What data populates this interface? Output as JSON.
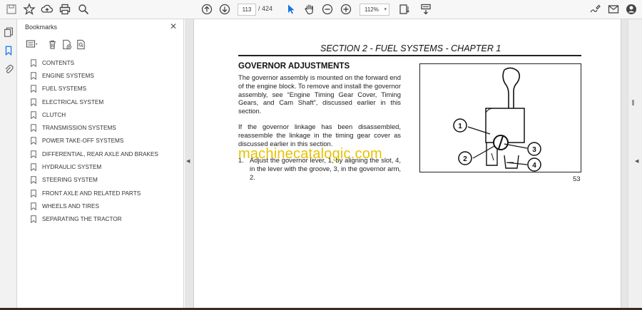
{
  "toolbar": {
    "current_page": "113",
    "page_separator": "/",
    "total_pages": "424",
    "zoom": "112%"
  },
  "bookmarks": {
    "title": "Bookmarks",
    "close_glyph": "✕",
    "items": [
      {
        "label": "CONTENTS"
      },
      {
        "label": "ENGINE SYSTEMS"
      },
      {
        "label": "FUEL SYSTEMS"
      },
      {
        "label": "ELECTRICAL SYSTEM"
      },
      {
        "label": "CLUTCH"
      },
      {
        "label": "TRANSMISSION SYSTEMS"
      },
      {
        "label": "POWER TAKE-OFF SYSTEMS"
      },
      {
        "label": "DIFFERENTIAL, REAR AXLE AND BRAKES"
      },
      {
        "label": "HYDRAULIC SYSTEM"
      },
      {
        "label": "STEERING SYSTEM"
      },
      {
        "label": "FRONT AXLE AND RELATED PARTS"
      },
      {
        "label": "WHEELS AND TIRES"
      },
      {
        "label": "SEPARATING THE TRACTOR"
      }
    ]
  },
  "document": {
    "section_header": "SECTION 2 - FUEL SYSTEMS - CHAPTER 1",
    "heading": "GOVERNOR ADJUSTMENTS",
    "paragraph1": "The governor assembly is mounted on the forward end of the engine block. To remove and install the governor assembly, see “Engine Timing Gear Cover, Timing Gears, and Cam Shaft”, discussed earlier in this section.",
    "paragraph2": "If the governor linkage has been disassembled, reassemble the linkage in the timing gear cover as discussed earlier in this section.",
    "step_number": "1.",
    "step_text": "Adjust the governor lever, 1, by aligning the slot, 4, in the lever with the groove, 3, in the governor arm, 2.",
    "figure_callouts": [
      "1",
      "2",
      "3",
      "4"
    ],
    "page_number": "53",
    "watermark": "machinecatalogic.com"
  },
  "colors": {
    "accent": "#1473e6",
    "watermark": "#e6c200"
  }
}
